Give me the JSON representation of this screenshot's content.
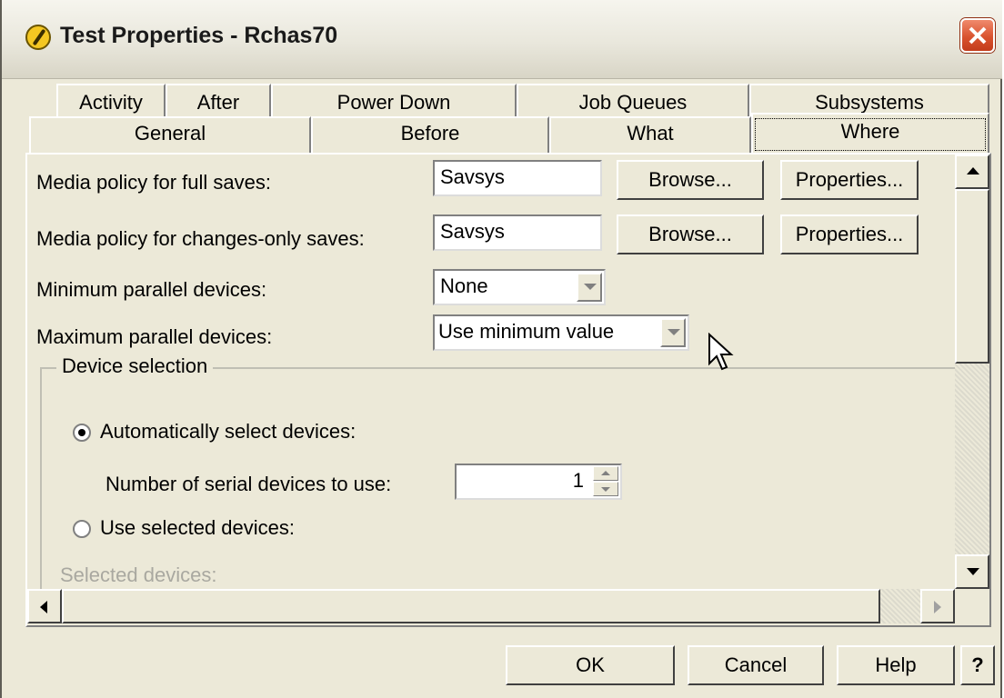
{
  "window": {
    "title": "Test Properties - Rchas70"
  },
  "tabs": {
    "row1": [
      "Activity",
      "After",
      "Power Down",
      "Job Queues",
      "Subsystems"
    ],
    "row2": [
      "General",
      "Before",
      "What",
      "Where"
    ],
    "selected": "Where"
  },
  "form": {
    "full_saves_label": "Media policy for full saves:",
    "full_saves_value": "Savsys",
    "changes_saves_label": "Media policy for changes-only saves:",
    "changes_saves_value": "Savsys",
    "browse_label": "Browse...",
    "properties_label": "Properties...",
    "min_parallel_label": "Minimum parallel devices:",
    "min_parallel_value": "None",
    "max_parallel_label": "Maximum parallel devices:",
    "max_parallel_value": "Use minimum value"
  },
  "device_selection": {
    "title": "Device selection",
    "auto_label": "Automatically select devices:",
    "auto_checked": true,
    "serial_label": "Number of serial devices to use:",
    "serial_value": "1",
    "use_selected_label": "Use selected devices:",
    "selected_devices_label": "Selected devices:"
  },
  "buttons": {
    "ok": "OK",
    "cancel": "Cancel",
    "help": "Help",
    "whats_this": "?"
  }
}
